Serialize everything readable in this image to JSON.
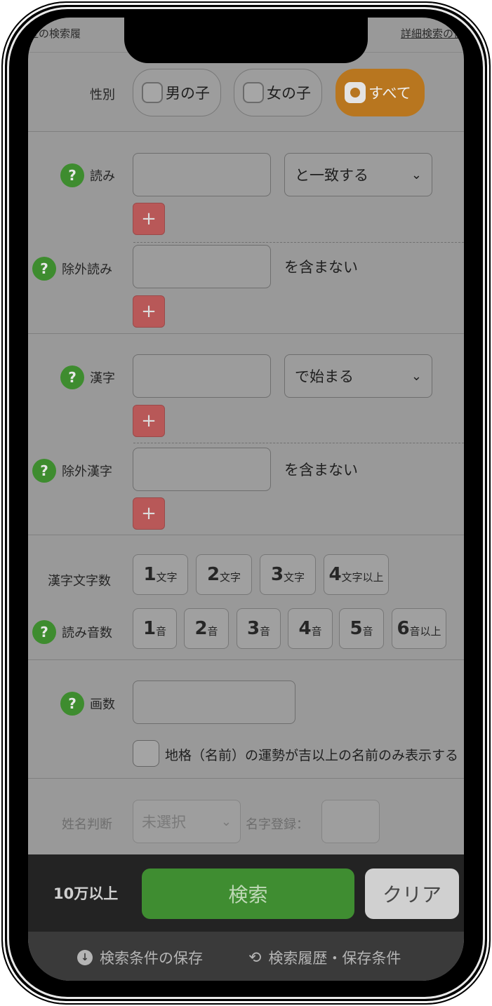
{
  "header": {
    "history_left": "近の検索履",
    "history_right": "詳細検索の使"
  },
  "gender": {
    "label": "性別",
    "options": [
      "男の子",
      "女の子",
      "すべて"
    ],
    "selected": "すべて"
  },
  "reading": {
    "label": "読み",
    "value": "",
    "match_mode": "と一致する",
    "add": "+"
  },
  "exclude_reading": {
    "label": "除外読み",
    "value": "",
    "suffix": "を含まない",
    "add": "+"
  },
  "kanji": {
    "label": "漢字",
    "value": "",
    "match_mode": "で始まる",
    "add": "+"
  },
  "exclude_kanji": {
    "label": "除外漢字",
    "value": "",
    "suffix": "を含まない",
    "add": "+"
  },
  "kanji_count": {
    "label": "漢字文字数",
    "options": [
      {
        "num": "1",
        "unit": "文字"
      },
      {
        "num": "2",
        "unit": "文字"
      },
      {
        "num": "3",
        "unit": "文字"
      },
      {
        "num": "4",
        "unit": "文字以上"
      }
    ]
  },
  "reading_sounds": {
    "label": "読み音数",
    "options": [
      {
        "num": "1",
        "unit": "音"
      },
      {
        "num": "2",
        "unit": "音"
      },
      {
        "num": "3",
        "unit": "音"
      },
      {
        "num": "4",
        "unit": "音"
      },
      {
        "num": "5",
        "unit": "音"
      },
      {
        "num": "6",
        "unit": "音以上"
      }
    ]
  },
  "strokes": {
    "label": "画数",
    "value": "",
    "checkbox_label": "地格（名前）の運勢が吉以上の名前のみ表示する"
  },
  "fortune": {
    "label": "姓名判断",
    "select_value": "未選択",
    "surname_label": "名字登録：",
    "surname_value": ""
  },
  "bottom_bar": {
    "count": "10万以上",
    "search": "検索",
    "clear": "クリア"
  },
  "footer": {
    "save": "検索条件の保存",
    "history": "検索履歴・保存条件"
  },
  "icons": {
    "help": "?",
    "chevron": "⌄"
  }
}
